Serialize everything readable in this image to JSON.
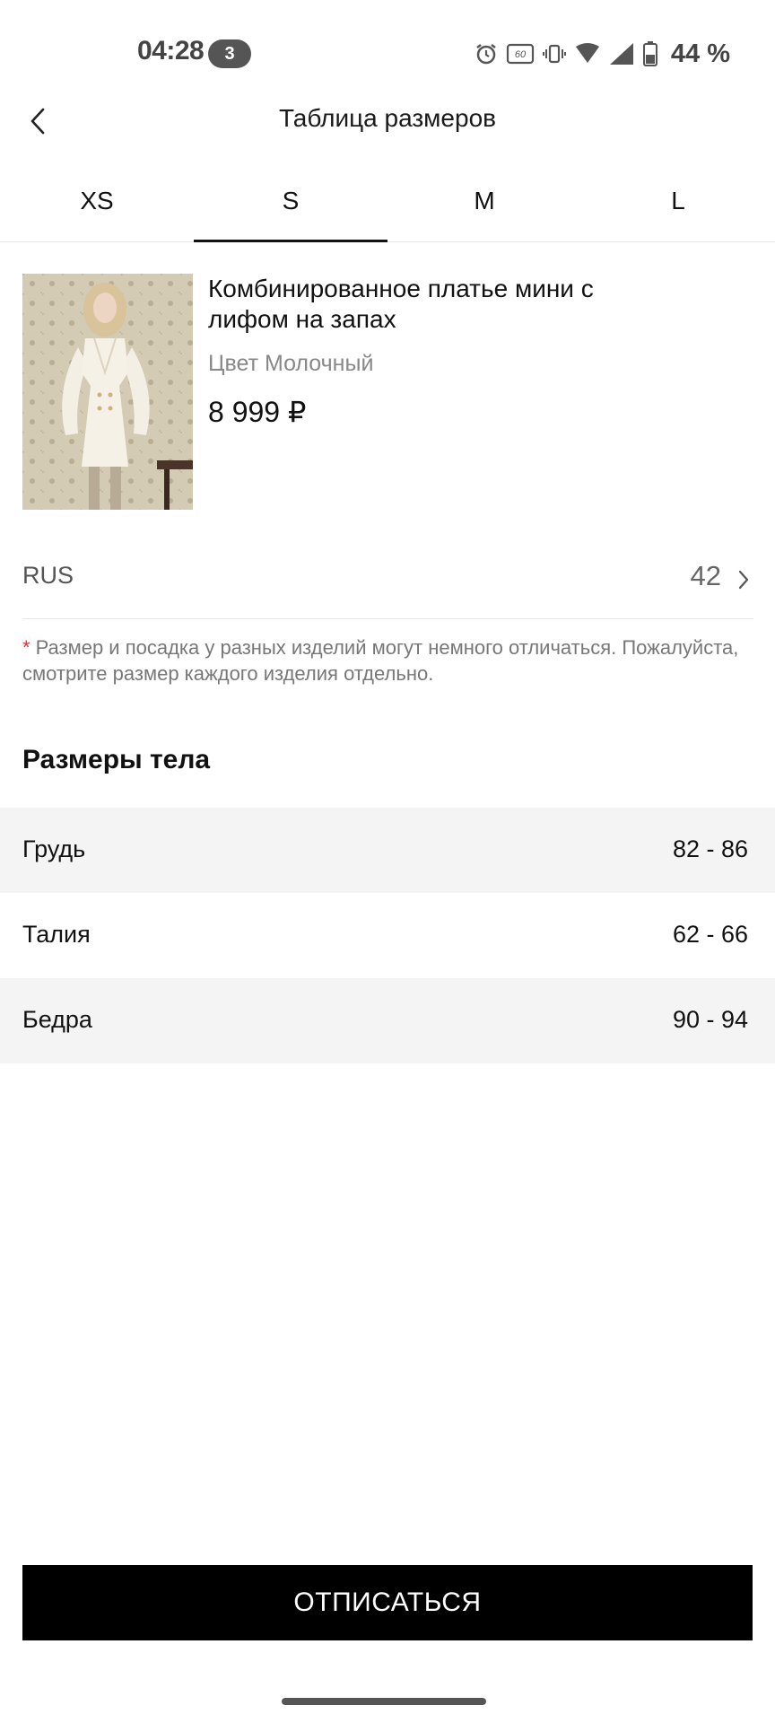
{
  "status_bar": {
    "time": "04:28",
    "notification_count": "3",
    "battery": "44 %",
    "icons": [
      "alarm-icon",
      "refresh-rate-icon",
      "vibrate-icon",
      "wifi-icon",
      "signal-icon",
      "battery-icon"
    ],
    "refresh_rate": "60"
  },
  "header": {
    "title": "Таблица размеров",
    "back_icon": "chevron-left-icon"
  },
  "tabs": [
    {
      "label": "XS",
      "active": false
    },
    {
      "label": "S",
      "active": true
    },
    {
      "label": "M",
      "active": false
    },
    {
      "label": "L",
      "active": false
    }
  ],
  "product": {
    "name": "Комбинированное платье мини с лифом на запах",
    "color": "Цвет Молочный",
    "price": "8 999 ₽"
  },
  "size_system": {
    "label": "RUS",
    "value": "42",
    "icon": "chevron-right-icon"
  },
  "note": {
    "asterisk": "*",
    "text": "Размер и посадка у разных изделий могут немного отличаться. Пожалуйста, смотрите размер каждого изделия отдельно."
  },
  "body_measurements": {
    "title": "Размеры тела",
    "rows": [
      {
        "label": "Грудь",
        "value": "82 - 86"
      },
      {
        "label": "Талия",
        "value": "62 - 66"
      },
      {
        "label": "Бедра",
        "value": "90 - 94"
      }
    ]
  },
  "cta": {
    "label": "ОТПИСАТЬСЯ"
  },
  "colors": {
    "accent": "#000000",
    "asterisk": "#dd3333",
    "shaded_row": "#f4f4f4"
  }
}
